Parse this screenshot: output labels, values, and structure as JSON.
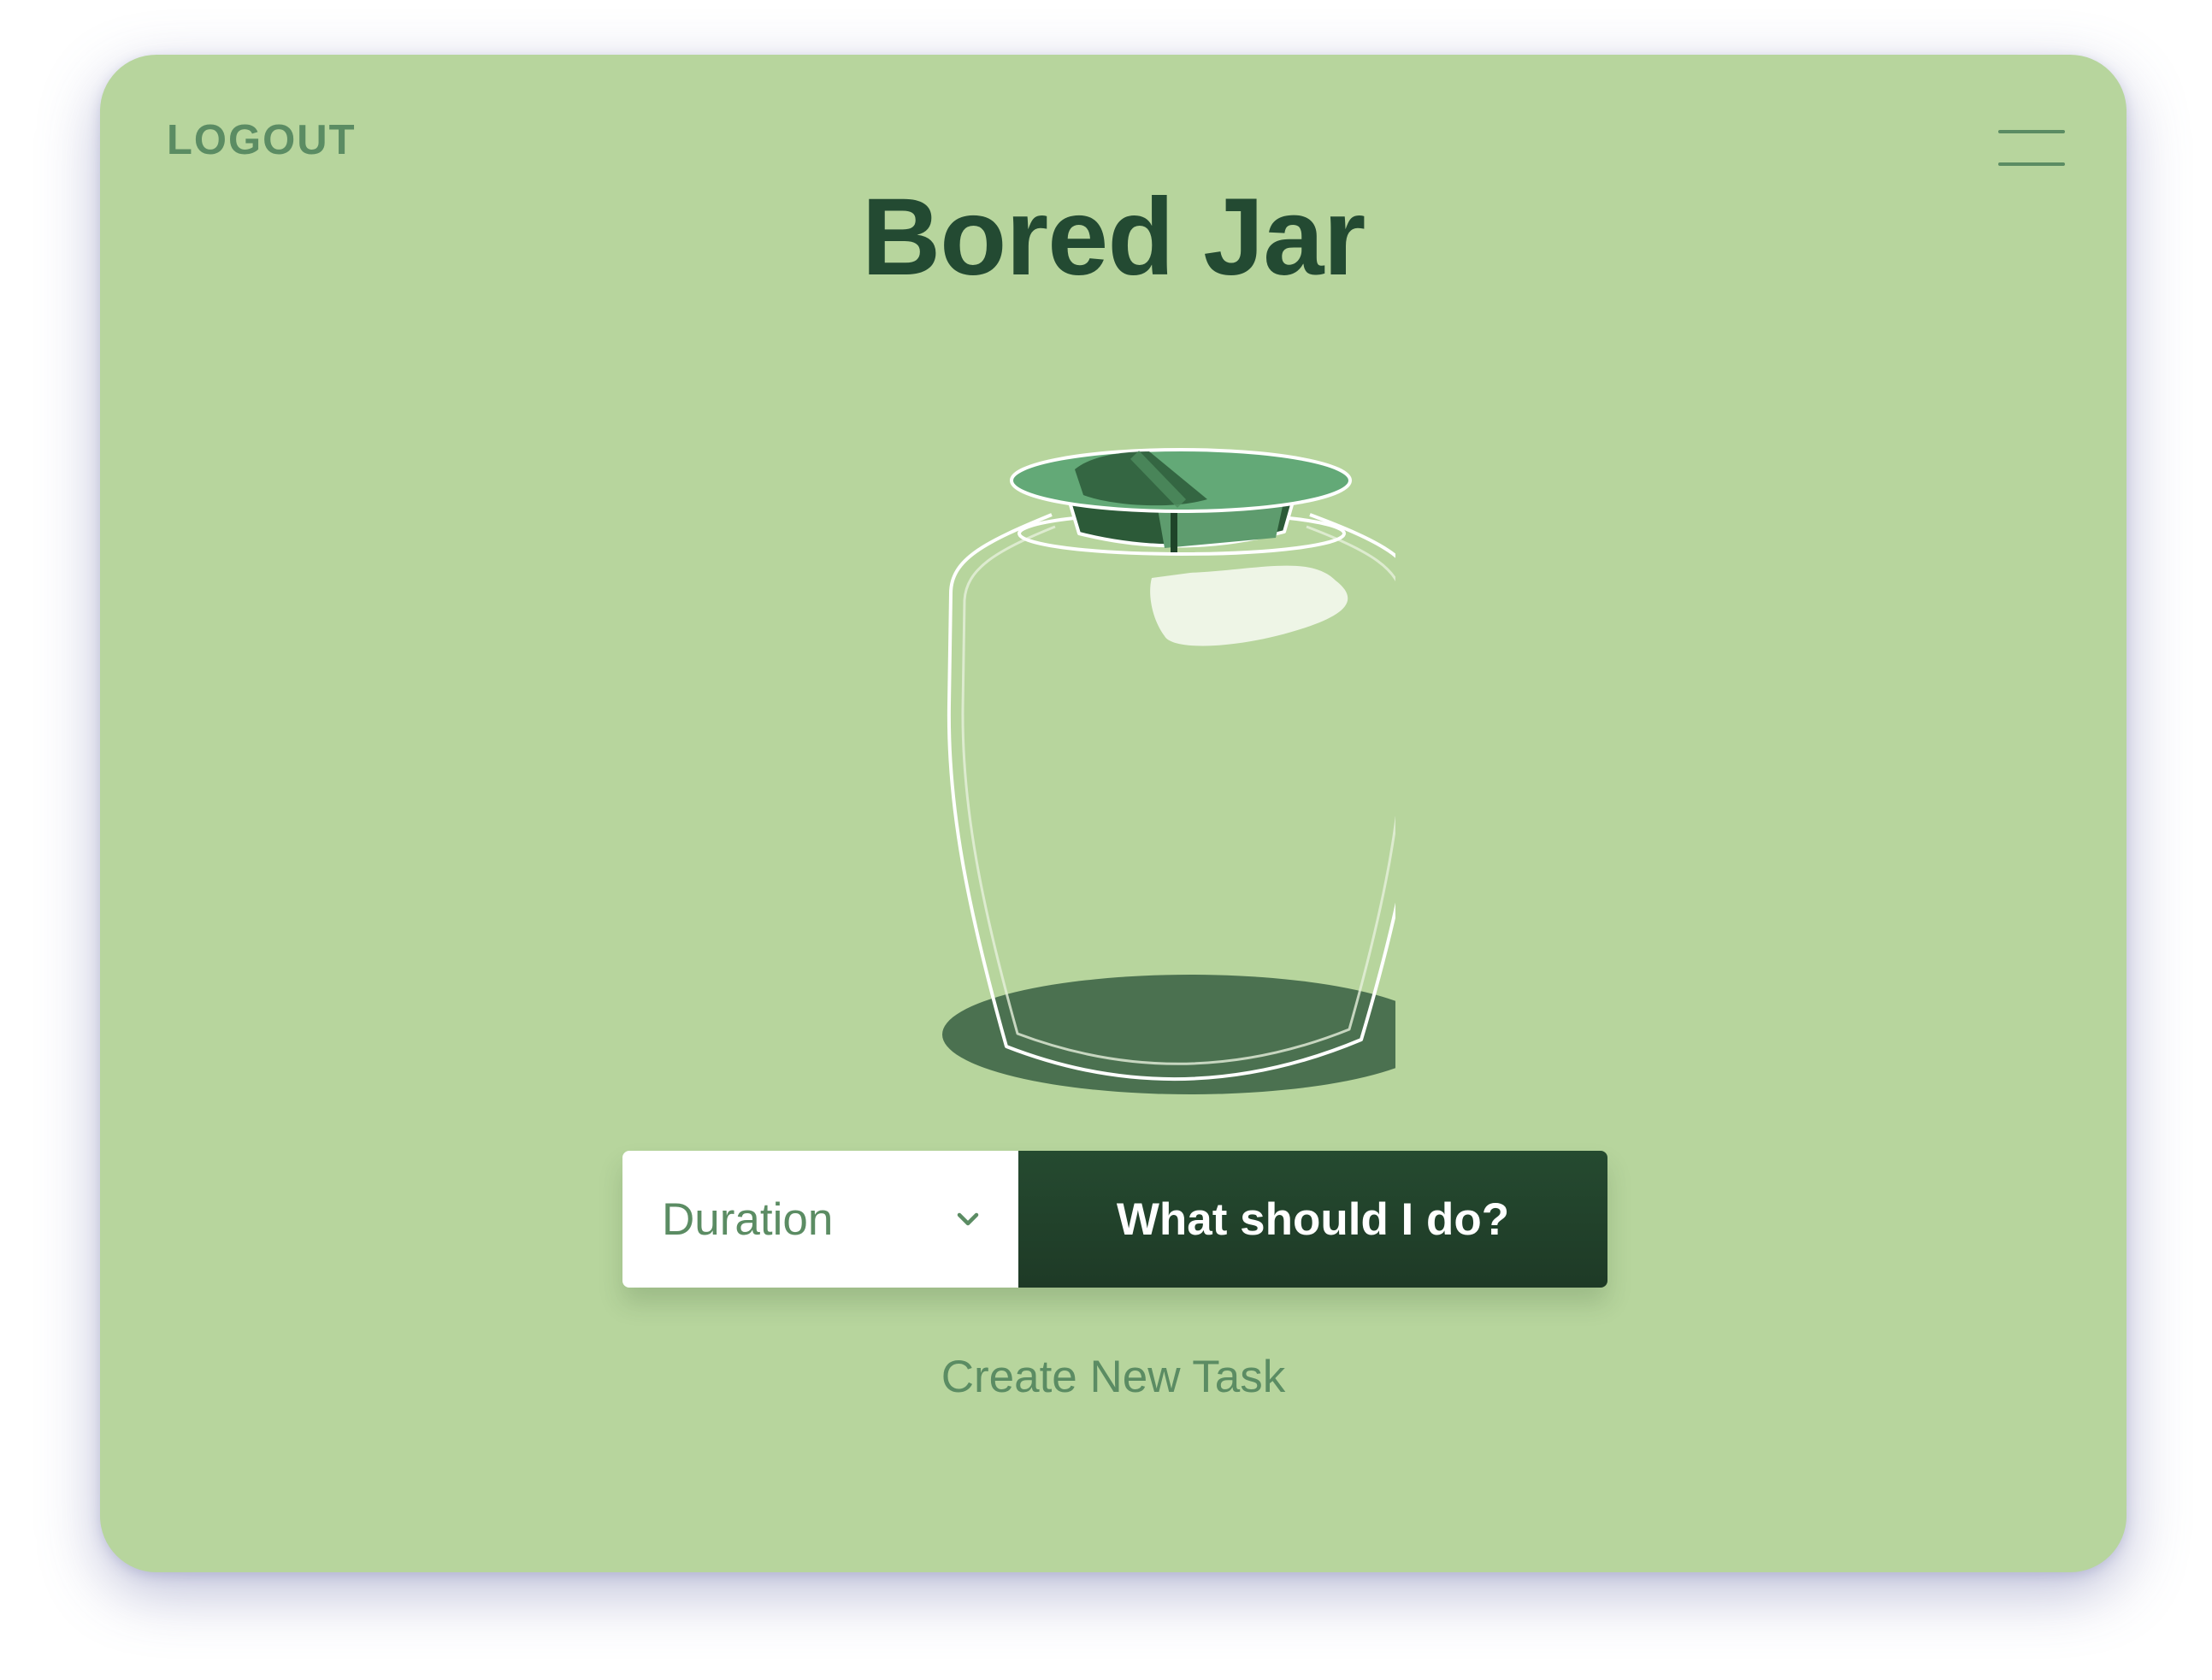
{
  "header": {
    "logout_label": "LOGOUT",
    "menu_icon": "hamburger-menu-icon"
  },
  "main": {
    "title": "Bored Jar",
    "illustration": "glass-jar",
    "duration_select": {
      "value": "Duration",
      "icon": "chevron-down-icon"
    },
    "action_button_label": "What should I do?",
    "create_task_label": "Create New Task"
  },
  "colors": {
    "background": "#b7d59d",
    "accent_dark": "#234a32",
    "muted_text": "#5b8c63",
    "lid_green": "#63a977"
  }
}
